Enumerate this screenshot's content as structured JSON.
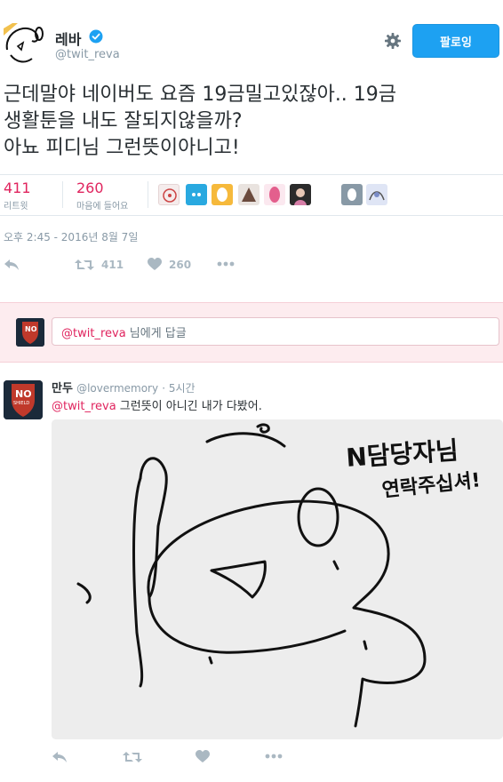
{
  "tweet": {
    "author_name": "레바",
    "author_handle": "@twit_reva",
    "follow_label": "팔로잉",
    "text_line1": "근데말야 네이버도 요즘 19금밀고있잖아.. 19금",
    "text_line2": "생활툰을 내도 잘되지않을까?",
    "text_line3": "아뇨 피디님 그런뜻이아니고!",
    "retweets_count": "411",
    "retweets_label": "리트윗",
    "likes_count": "260",
    "likes_label": "마음에 들어요",
    "timestamp": "오후 2:45 - 2016년 8월 7일",
    "action_retweet_count": "411",
    "action_like_count": "260"
  },
  "reply_box": {
    "mention": "@twit_reva",
    "rest": " 님에게 답글"
  },
  "reply": {
    "author_name": "만두",
    "author_handle": "@lovermemory",
    "time": "· 5시간",
    "mention": "@twit_reva",
    "text": " 그런뜻이 아니긴 내가 다봤어.",
    "image_caption_line1": "N담당자님",
    "image_caption_line2": "연락주십셔!"
  },
  "avatar_text": {
    "no": "NO",
    "shield": "SHIELD"
  },
  "icons": {
    "reply": "reply-icon",
    "retweet": "retweet-icon",
    "like": "heart-icon",
    "more": "more-icon",
    "settings": "gear-icon",
    "verified": "verified-badge-icon"
  },
  "colors": {
    "follow_button": "#1da1f2",
    "counts": "#e0245e",
    "mention": "#e0245e",
    "reply_band": "#fdecef"
  }
}
